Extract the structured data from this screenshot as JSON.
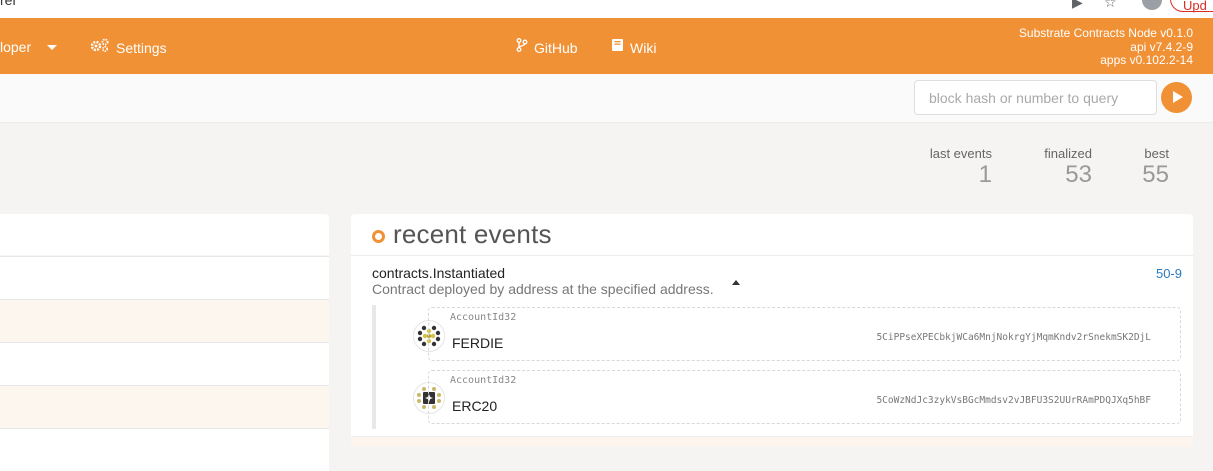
{
  "browser": {
    "tab_fragment": "rer",
    "update_label": "Upd"
  },
  "nav": {
    "developer_label": "loper",
    "settings_label": "Settings",
    "github_label": "GitHub",
    "wiki_label": "Wiki",
    "node_name": "Substrate Contracts Node v0.1.0",
    "api_version": "api v7.4.2-9",
    "apps_version": "apps v0.102.2-14"
  },
  "query": {
    "placeholder": "block hash or number to query"
  },
  "summary": {
    "last_events_label": "last events",
    "last_events_value": "1",
    "finalized_label": "finalized",
    "finalized_value": "53",
    "best_label": "best",
    "best_value": "55"
  },
  "events": {
    "title": "recent events",
    "items": [
      {
        "name": "contracts.Instantiated",
        "description": "Contract deployed by address at the specified address.",
        "block_ref": "50-9",
        "params": [
          {
            "type": "AccountId32",
            "name": "FERDIE",
            "address": "5CiPPseXPECbkjWCa6MnjNokrgYjMqmKndv2rSnekmSK2DjL"
          },
          {
            "type": "AccountId32",
            "name": "ERC20",
            "address": "5CoWzNdJc3zykVsBGcMmdsv2vJBFU3S2UUrRAmPDQJXq5hBF"
          }
        ]
      }
    ]
  },
  "colors": {
    "accent": "#f19135",
    "link": "#2a7bc0"
  }
}
